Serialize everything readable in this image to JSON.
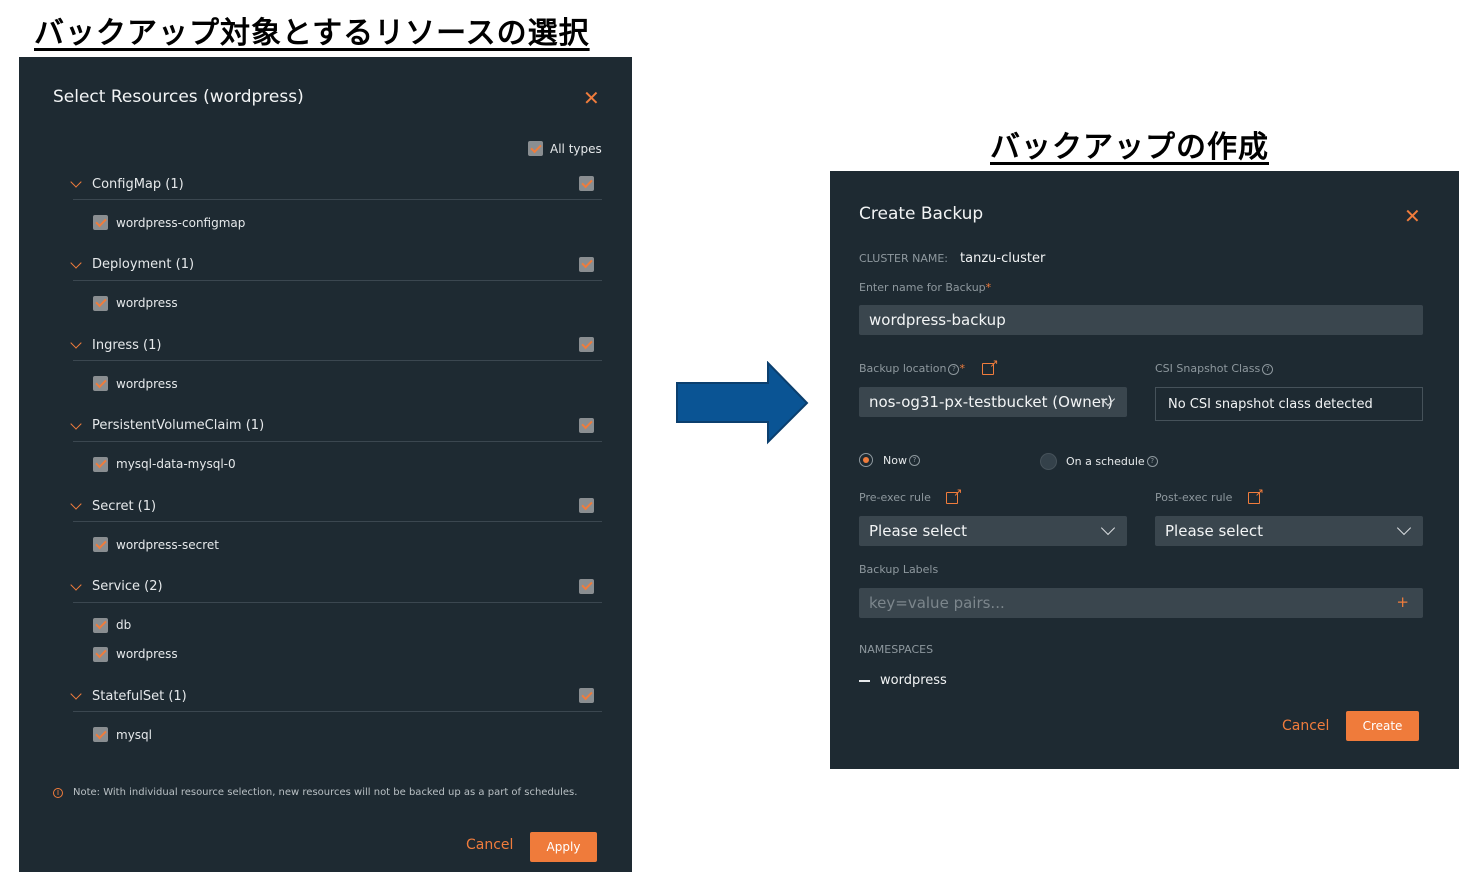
{
  "left_heading": "バックアップ対象とするリソースの選択",
  "right_heading": "バックアップの作成",
  "select_dialog": {
    "title": "Select Resources (wordpress)",
    "all_types_label": "All types",
    "groups": [
      {
        "label": "ConfigMap (1)",
        "items": [
          "wordpress-configmap"
        ]
      },
      {
        "label": "Deployment (1)",
        "items": [
          "wordpress"
        ]
      },
      {
        "label": "Ingress (1)",
        "items": [
          "wordpress"
        ]
      },
      {
        "label": "PersistentVolumeClaim (1)",
        "items": [
          "mysql-data-mysql-0"
        ]
      },
      {
        "label": "Secret (1)",
        "items": [
          "wordpress-secret"
        ]
      },
      {
        "label": "Service (2)",
        "items": [
          "db",
          "wordpress"
        ]
      },
      {
        "label": "StatefulSet (1)",
        "items": [
          "mysql"
        ]
      }
    ],
    "note": "Note: With individual resource selection, new resources will not be backed up as a part of schedules.",
    "cancel_label": "Cancel",
    "apply_label": "Apply"
  },
  "create_dialog": {
    "title": "Create Backup",
    "cluster_name_label": "CLUSTER NAME:",
    "cluster_name_value": "tanzu-cluster",
    "backup_name_label": "Enter name for Backup",
    "backup_name_value": "wordpress-backup",
    "backup_location_label": "Backup location",
    "backup_location_value": "nos-og31-px-testbucket (Owner)",
    "csi_label": "CSI Snapshot Class",
    "csi_value": "No CSI snapshot class detected",
    "now_label": "Now",
    "schedule_label": "On a schedule",
    "pre_exec_label": "Pre-exec rule",
    "pre_exec_value": "Please select",
    "post_exec_label": "Post-exec rule",
    "post_exec_value": "Please select",
    "labels_label": "Backup Labels",
    "labels_placeholder": "key=value pairs...",
    "namespaces_label": "NAMESPACES",
    "namespace_item": "wordpress",
    "cancel_label": "Cancel",
    "create_label": "Create"
  },
  "colors": {
    "panel": "#1e2a32",
    "accent": "#ef7b3b",
    "arrow": "#0a5494"
  }
}
